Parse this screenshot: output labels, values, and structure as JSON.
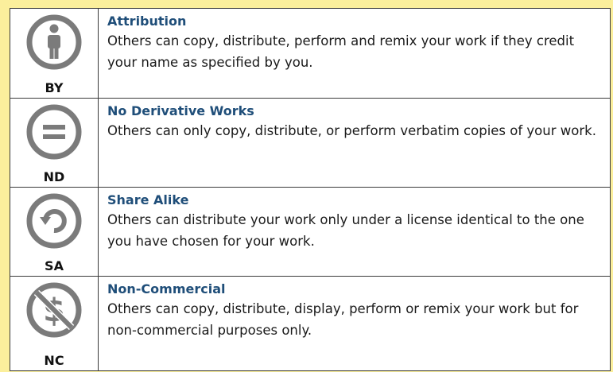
{
  "licenses": [
    {
      "code": "BY",
      "icon": "attribution-person-icon",
      "title": "Attribution",
      "description": "Others can copy, distribute, perform and remix your work if they credit your name as specified by you."
    },
    {
      "code": "ND",
      "icon": "no-derivatives-equals-icon",
      "title": "No Derivative Works",
      "description": "Others can only copy, distribute, or perform verbatim copies of your work."
    },
    {
      "code": "SA",
      "icon": "share-alike-arrow-icon",
      "title": "Share Alike",
      "description": "Others can distribute your work only under a license identical to the one you have chosen for your work."
    },
    {
      "code": "NC",
      "icon": "non-commercial-dollar-icon",
      "title": "Non-Commercial",
      "description": "Others can copy, distribute, display, perform or remix your work but for non-commercial purposes only."
    }
  ],
  "colors": {
    "background": "#fbef9c",
    "title": "#1f4e79",
    "icon": "#7b7b7b"
  }
}
